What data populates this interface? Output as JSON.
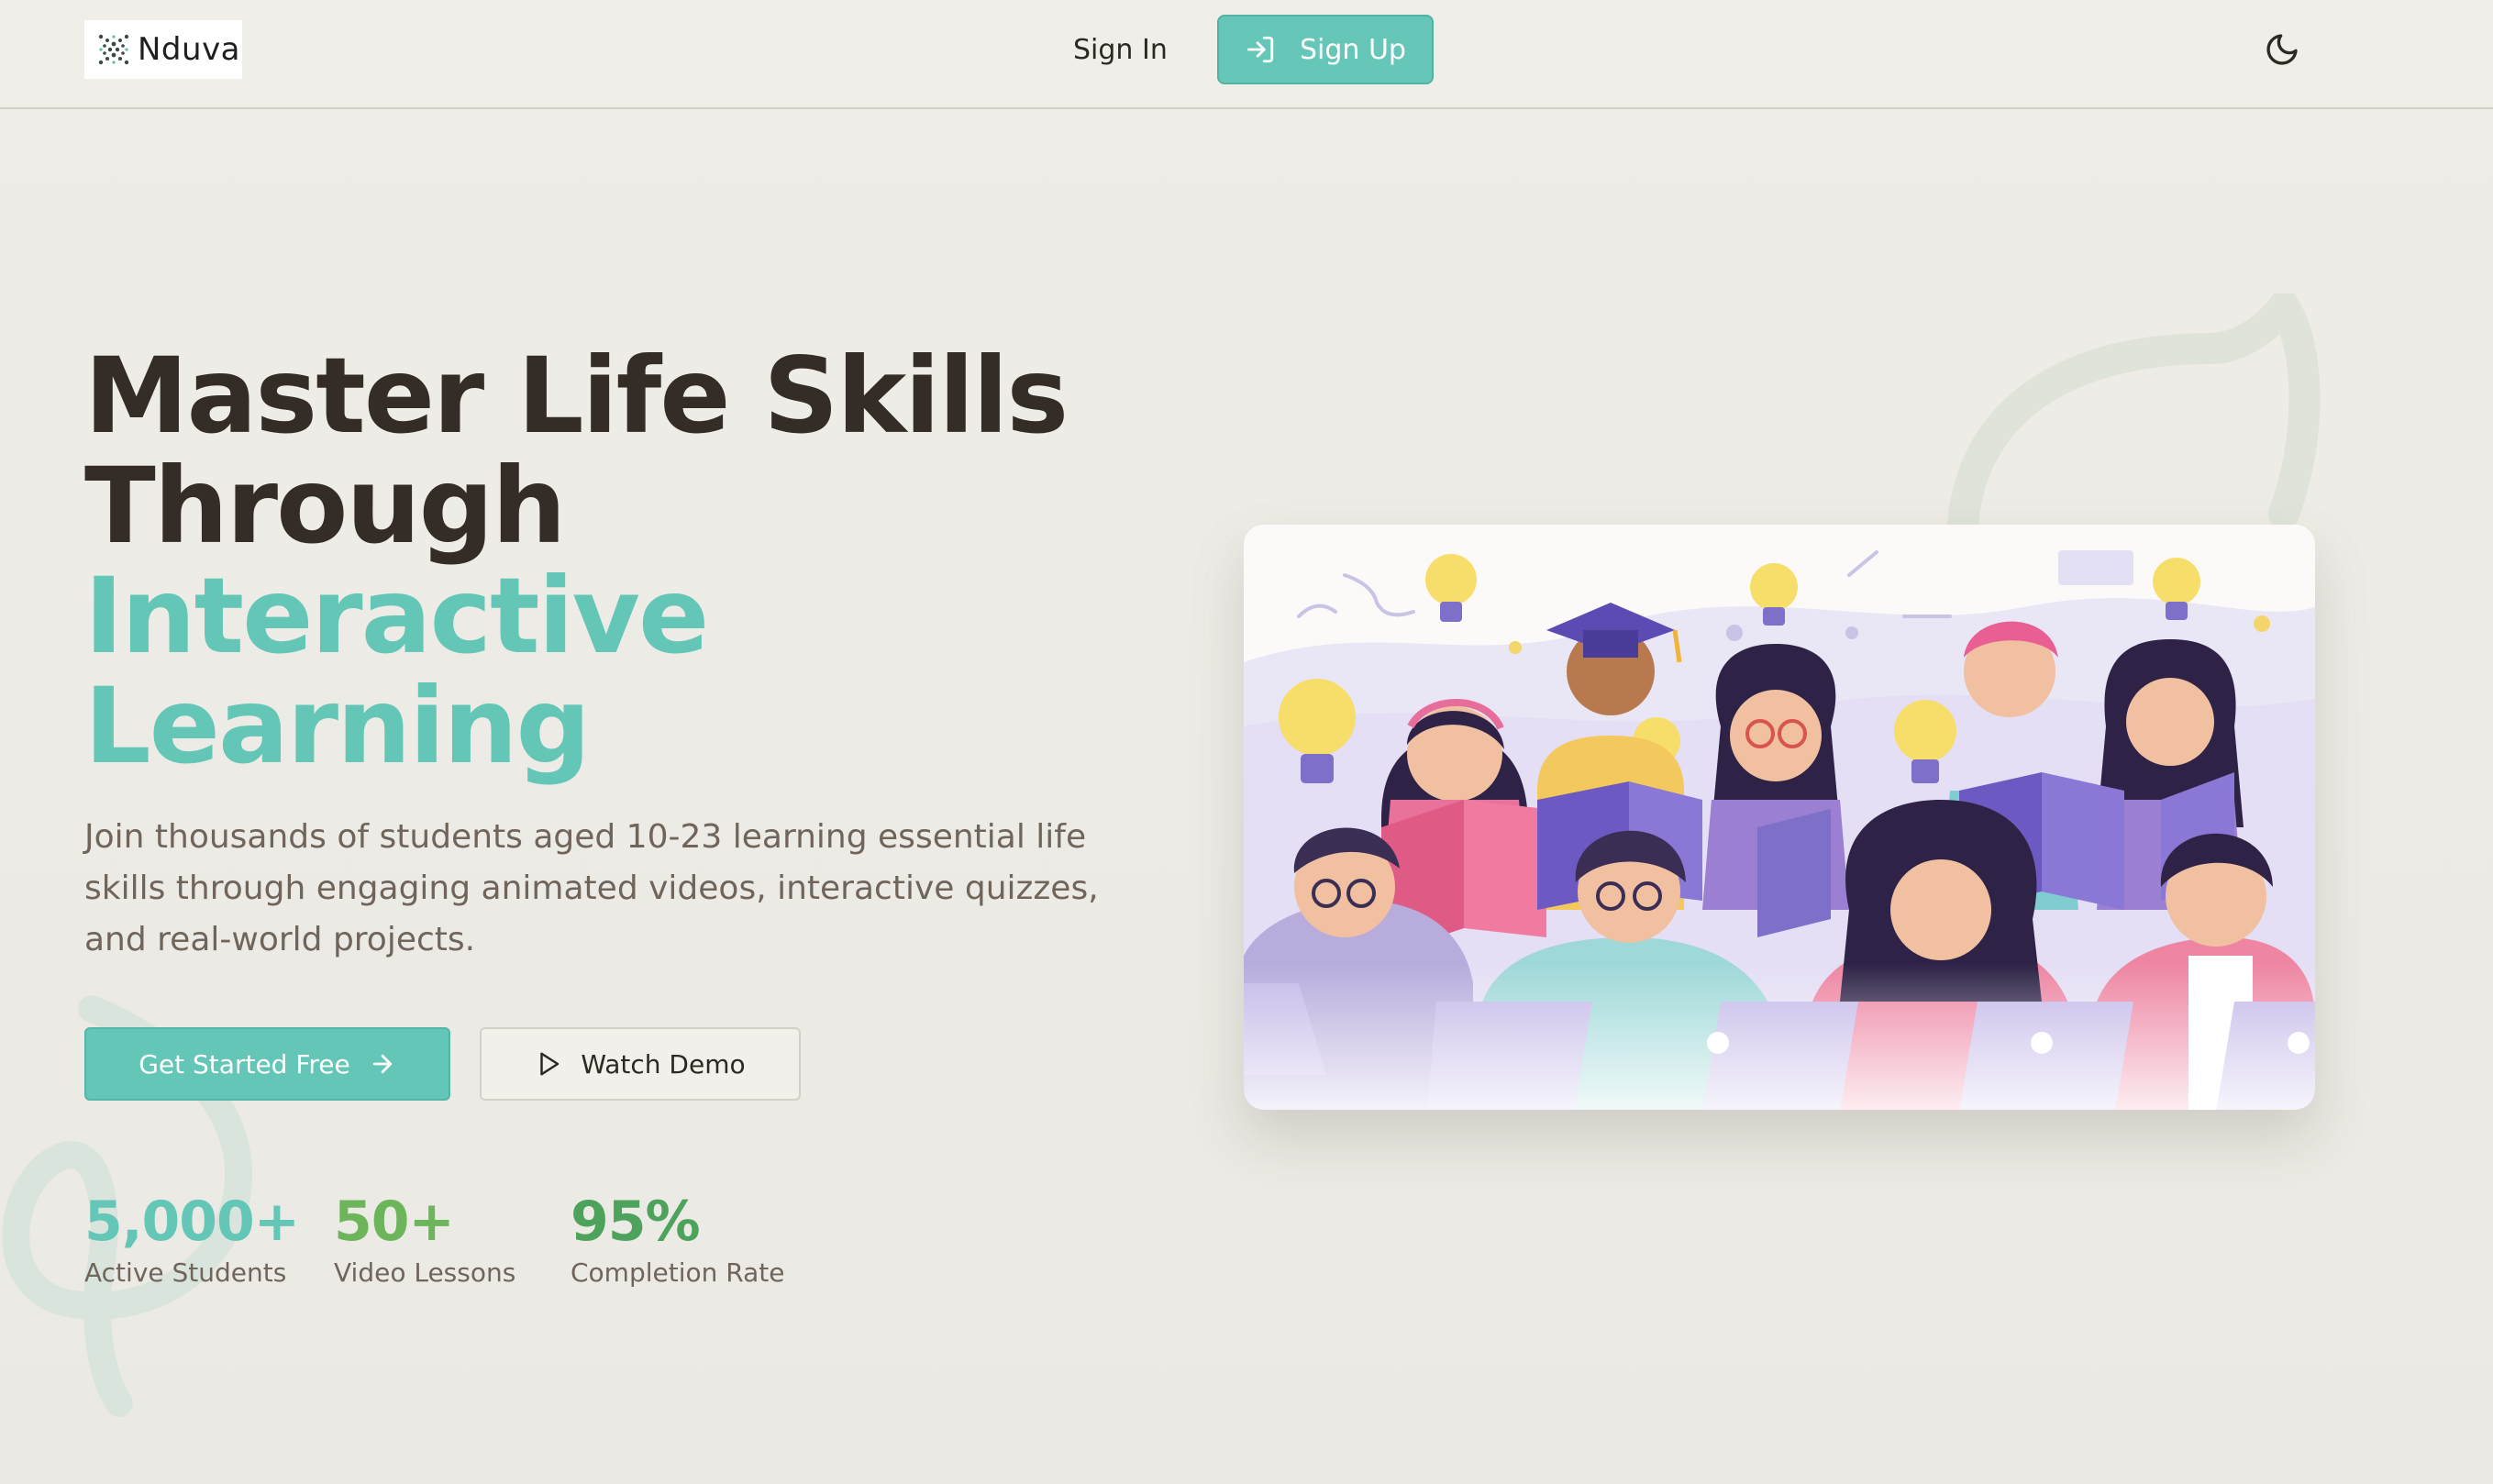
{
  "header": {
    "logo_text": "Nduva",
    "signin_label": "Sign In",
    "signup_label": "Sign Up",
    "theme_toggle_icon": "moon-icon"
  },
  "hero": {
    "headline_line1": "Master Life Skills",
    "headline_line2": "Through",
    "headline_line3": "Interactive",
    "headline_line4": "Learning",
    "subtitle": "Join thousands of students aged 10-23 learning essential life skills through engaging animated videos, interactive quizzes, and real-world projects.",
    "primary_cta": "Get Started Free",
    "secondary_cta": "Watch Demo",
    "stats": [
      {
        "value": "5,000+",
        "label": "Active Students"
      },
      {
        "value": "50+",
        "label": "Video Lessons"
      },
      {
        "value": "95%",
        "label": "Completion Rate"
      }
    ]
  },
  "colors": {
    "accent_teal": "#63c6b6",
    "stat_green": "#6cb55b",
    "stat_dark_green": "#4da35c",
    "heading_dark": "#342d27",
    "background": "#eeece6"
  },
  "icons": {
    "signup": "sign-in-arrow-icon",
    "primary_cta": "arrow-right-icon",
    "secondary_cta": "play-icon",
    "theme": "moon-icon"
  }
}
